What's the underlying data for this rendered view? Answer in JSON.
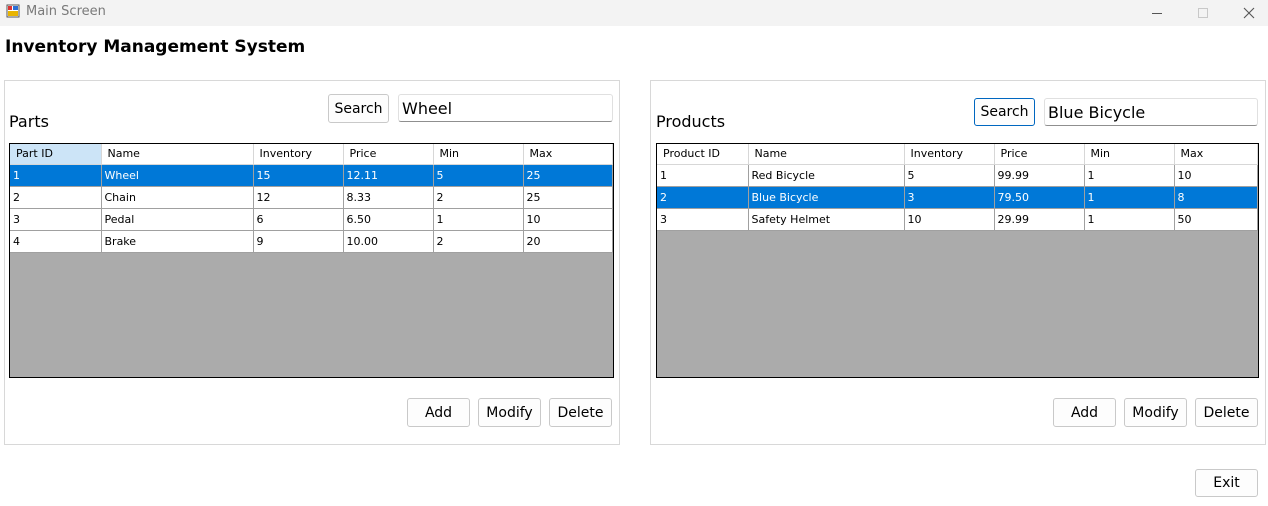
{
  "window": {
    "title": "Main Screen"
  },
  "header": {
    "title": "Inventory Management System"
  },
  "parts": {
    "label": "Parts",
    "search_button": "Search",
    "search_value": "Wheel",
    "columns": [
      "Part ID",
      "Name",
      "Inventory",
      "Price",
      "Min",
      "Max"
    ],
    "rows": [
      [
        "1",
        "Wheel",
        "15",
        "12.11",
        "5",
        "25"
      ],
      [
        "2",
        "Chain",
        "12",
        "8.33",
        "2",
        "25"
      ],
      [
        "3",
        "Pedal",
        "6",
        "6.50",
        "1",
        "10"
      ],
      [
        "4",
        "Brake",
        "9",
        "10.00",
        "2",
        "20"
      ]
    ],
    "selected_row": 0,
    "add_button": "Add",
    "modify_button": "Modify",
    "delete_button": "Delete"
  },
  "products": {
    "label": "Products",
    "search_button": "Search",
    "search_value": "Blue Bicycle",
    "columns": [
      "Product ID",
      "Name",
      "Inventory",
      "Price",
      "Min",
      "Max"
    ],
    "rows": [
      [
        "1",
        "Red Bicycle",
        "5",
        "99.99",
        "1",
        "10"
      ],
      [
        "2",
        "Blue Bicycle",
        "3",
        "79.50",
        "1",
        "8"
      ],
      [
        "3",
        "Safety Helmet",
        "10",
        "29.99",
        "1",
        "50"
      ]
    ],
    "selected_row": 1,
    "add_button": "Add",
    "modify_button": "Modify",
    "delete_button": "Delete"
  },
  "footer": {
    "exit_button": "Exit"
  },
  "colors": {
    "selection": "#0078d7",
    "grid_background": "#ababab",
    "header_highlight": "#cce4f7",
    "focus_border": "#0067c0"
  }
}
